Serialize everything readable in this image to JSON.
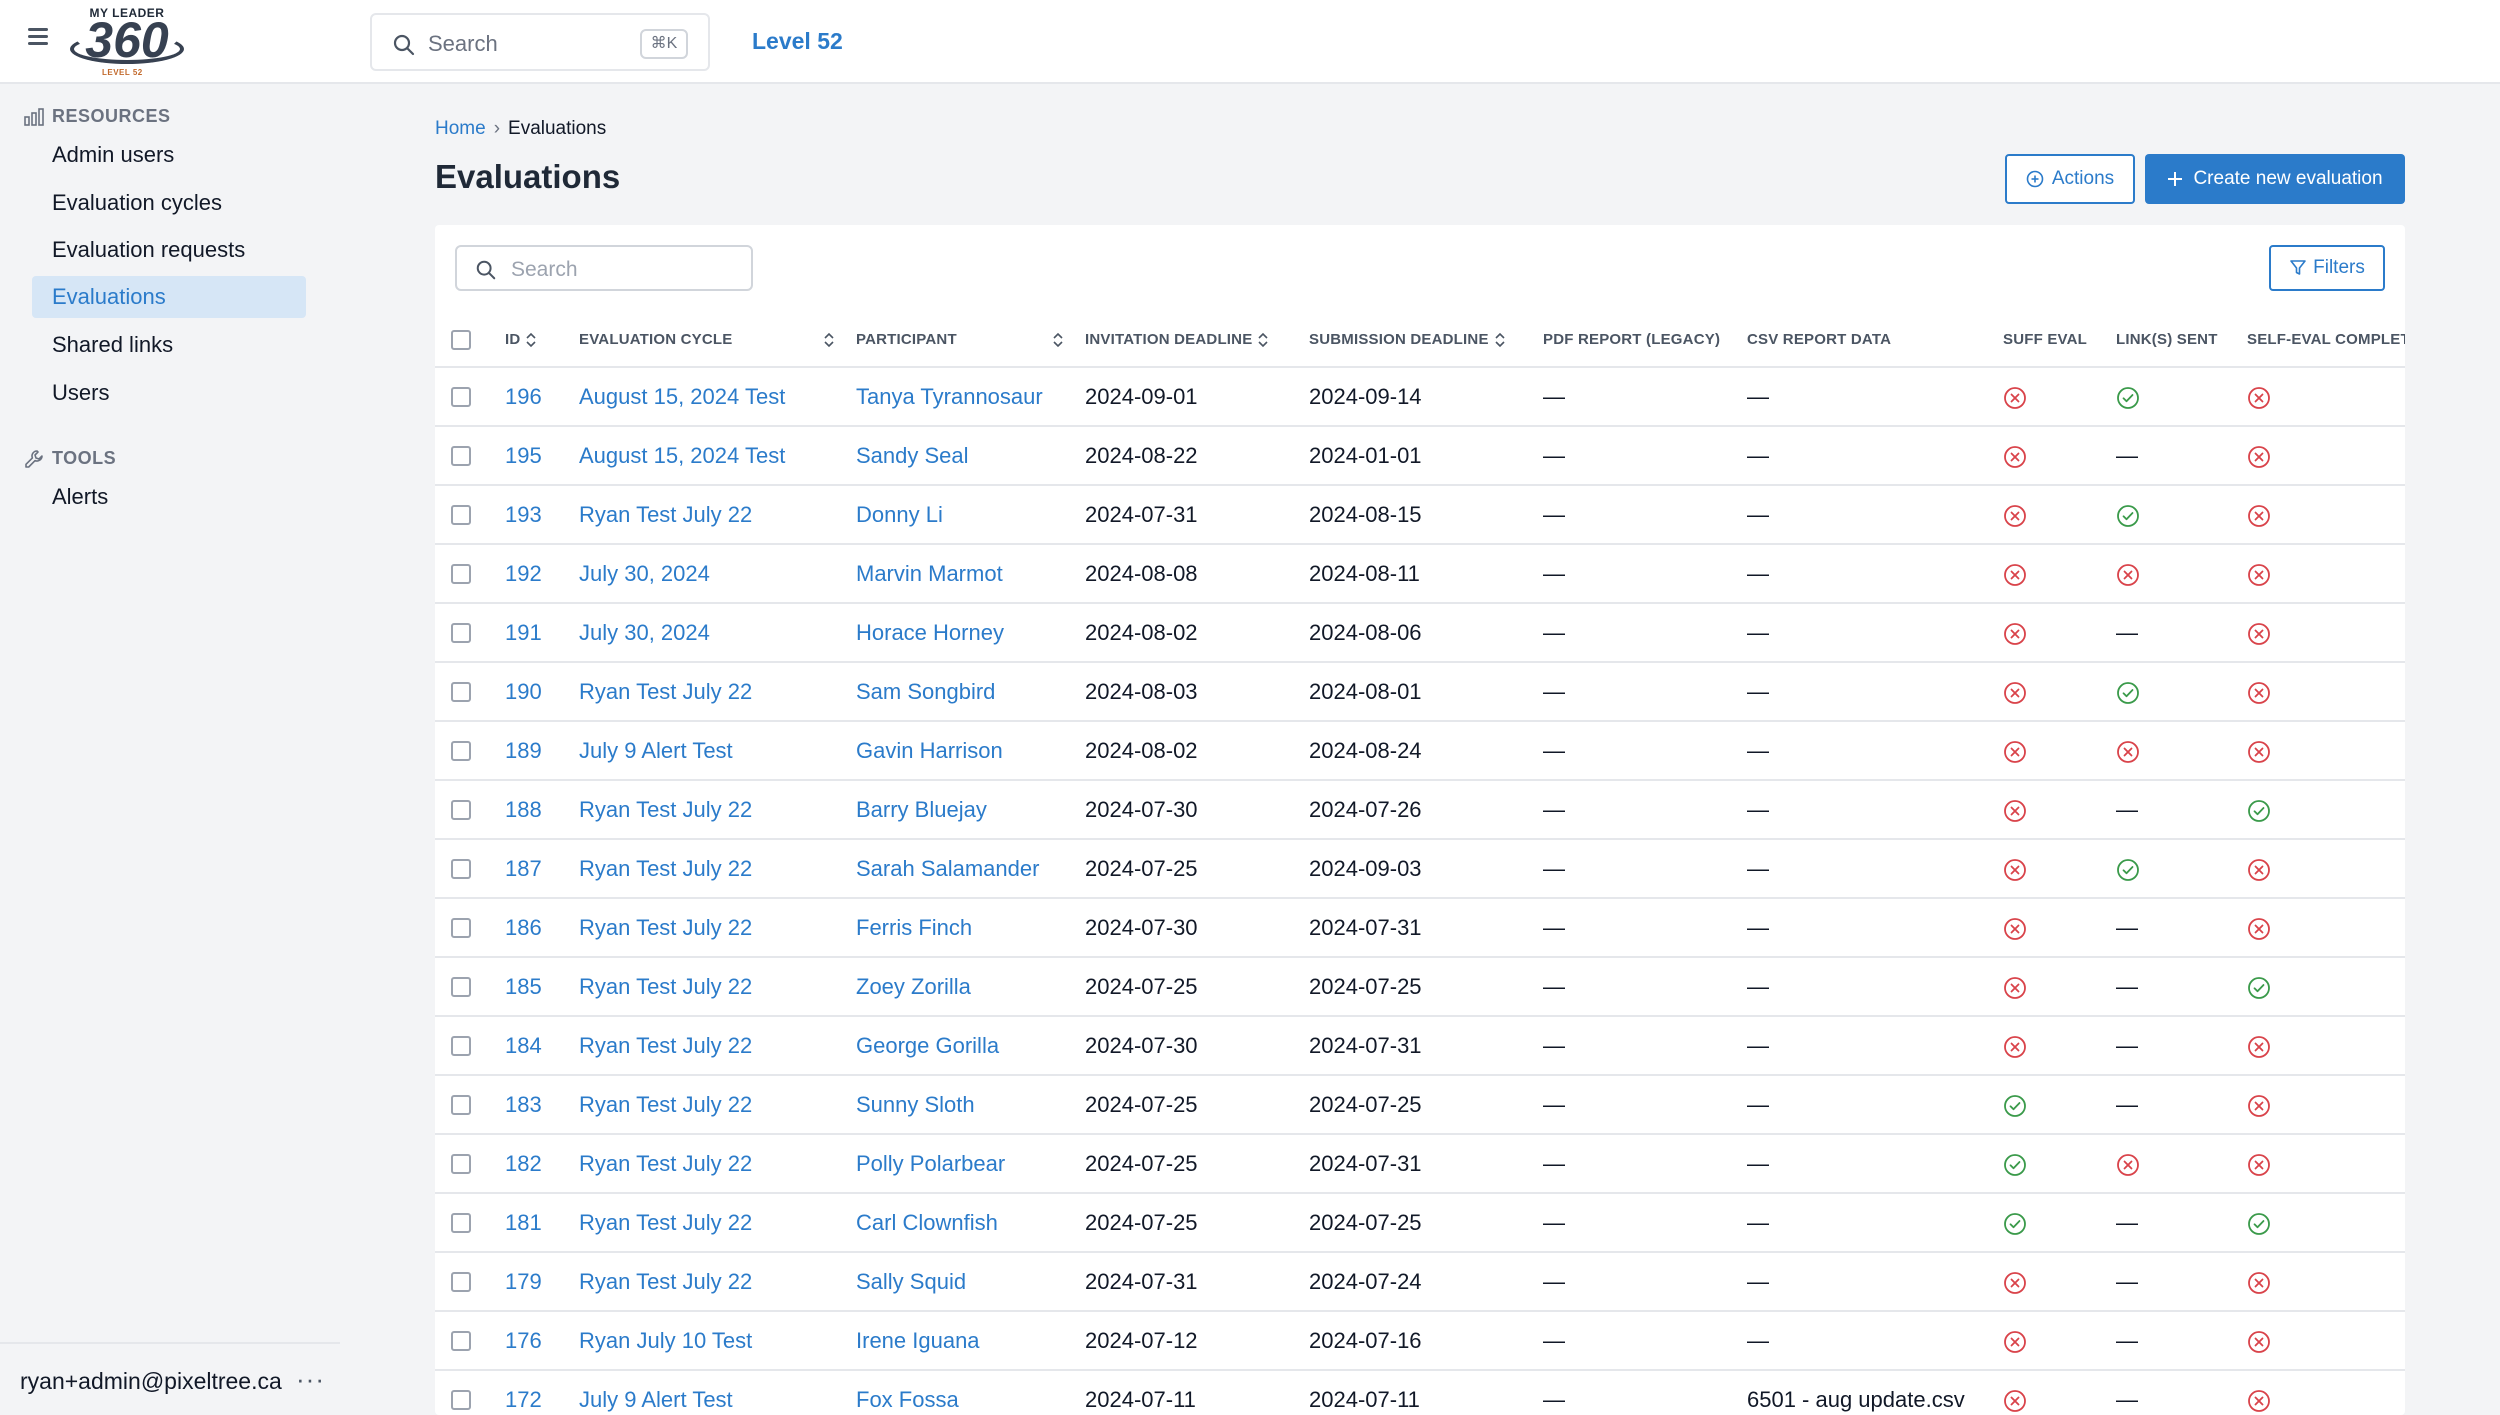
{
  "header": {
    "logo": {
      "top": "MY LEADER",
      "num": "360",
      "sub": "LEVEL 52"
    },
    "search_placeholder": "Search",
    "shortcut": "⌘K",
    "brand_link": "Level 52"
  },
  "sidebar": {
    "resources_label": "RESOURCES",
    "items": [
      {
        "label": "Admin users"
      },
      {
        "label": "Evaluation cycles"
      },
      {
        "label": "Evaluation requests"
      },
      {
        "label": "Evaluations"
      },
      {
        "label": "Shared links"
      },
      {
        "label": "Users"
      }
    ],
    "tools_label": "TOOLS",
    "tools": [
      {
        "label": "Alerts"
      }
    ],
    "user_email": "ryan+admin@pixeltree.ca",
    "more": "···"
  },
  "breadcrumb": {
    "home": "Home",
    "sep": "›",
    "current": "Evaluations"
  },
  "page": {
    "title": "Evaluations",
    "actions_label": "Actions",
    "create_label": "Create new evaluation",
    "search_placeholder": "Search",
    "filters_label": "Filters"
  },
  "table": {
    "headers": {
      "id": "ID",
      "cycle": "EVALUATION CYCLE",
      "participant": "PARTICIPANT",
      "invitation": "INVITATION DEADLINE",
      "submission": "SUBMISSION DEADLINE",
      "pdf": "PDF REPORT (LEGACY)",
      "csv": "CSV REPORT DATA",
      "suff": "SUFF EVAL",
      "links": "LINK(S) SENT",
      "self": "SELF-EVAL COMPLET"
    },
    "rows": [
      {
        "id": "196",
        "cycle": "August 15, 2024 Test",
        "participant": "Tanya Tyrannosaur",
        "inv": "2024-09-01",
        "sub": "2024-09-14",
        "pdf": "—",
        "csv": "—",
        "suff": "no",
        "links": "yes",
        "self": "no"
      },
      {
        "id": "195",
        "cycle": "August 15, 2024 Test",
        "participant": "Sandy Seal",
        "inv": "2024-08-22",
        "sub": "2024-01-01",
        "pdf": "—",
        "csv": "—",
        "suff": "no",
        "links": "none",
        "self": "no"
      },
      {
        "id": "193",
        "cycle": "Ryan Test July 22",
        "participant": "Donny Li",
        "inv": "2024-07-31",
        "sub": "2024-08-15",
        "pdf": "—",
        "csv": "—",
        "suff": "no",
        "links": "yes",
        "self": "no"
      },
      {
        "id": "192",
        "cycle": "July 30, 2024",
        "participant": "Marvin Marmot",
        "inv": "2024-08-08",
        "sub": "2024-08-11",
        "pdf": "—",
        "csv": "—",
        "suff": "no",
        "links": "no",
        "self": "no"
      },
      {
        "id": "191",
        "cycle": "July 30, 2024",
        "participant": "Horace Horney",
        "inv": "2024-08-02",
        "sub": "2024-08-06",
        "pdf": "—",
        "csv": "—",
        "suff": "no",
        "links": "none",
        "self": "no"
      },
      {
        "id": "190",
        "cycle": "Ryan Test July 22",
        "participant": "Sam Songbird",
        "inv": "2024-08-03",
        "sub": "2024-08-01",
        "pdf": "—",
        "csv": "—",
        "suff": "no",
        "links": "yes",
        "self": "no"
      },
      {
        "id": "189",
        "cycle": "July 9 Alert Test",
        "participant": "Gavin Harrison",
        "inv": "2024-08-02",
        "sub": "2024-08-24",
        "pdf": "—",
        "csv": "—",
        "suff": "no",
        "links": "no",
        "self": "no"
      },
      {
        "id": "188",
        "cycle": "Ryan Test July 22",
        "participant": "Barry Bluejay",
        "inv": "2024-07-30",
        "sub": "2024-07-26",
        "pdf": "—",
        "csv": "—",
        "suff": "no",
        "links": "none",
        "self": "yes"
      },
      {
        "id": "187",
        "cycle": "Ryan Test July 22",
        "participant": "Sarah Salamander",
        "inv": "2024-07-25",
        "sub": "2024-09-03",
        "pdf": "—",
        "csv": "—",
        "suff": "no",
        "links": "yes",
        "self": "no"
      },
      {
        "id": "186",
        "cycle": "Ryan Test July 22",
        "participant": "Ferris Finch",
        "inv": "2024-07-30",
        "sub": "2024-07-31",
        "pdf": "—",
        "csv": "—",
        "suff": "no",
        "links": "none",
        "self": "no"
      },
      {
        "id": "185",
        "cycle": "Ryan Test July 22",
        "participant": "Zoey Zorilla",
        "inv": "2024-07-25",
        "sub": "2024-07-25",
        "pdf": "—",
        "csv": "—",
        "suff": "no",
        "links": "none",
        "self": "yes"
      },
      {
        "id": "184",
        "cycle": "Ryan Test July 22",
        "participant": "George Gorilla",
        "inv": "2024-07-30",
        "sub": "2024-07-31",
        "pdf": "—",
        "csv": "—",
        "suff": "no",
        "links": "none",
        "self": "no"
      },
      {
        "id": "183",
        "cycle": "Ryan Test July 22",
        "participant": "Sunny Sloth",
        "inv": "2024-07-25",
        "sub": "2024-07-25",
        "pdf": "—",
        "csv": "—",
        "suff": "yes",
        "links": "none",
        "self": "no"
      },
      {
        "id": "182",
        "cycle": "Ryan Test July 22",
        "participant": "Polly Polarbear",
        "inv": "2024-07-25",
        "sub": "2024-07-31",
        "pdf": "—",
        "csv": "—",
        "suff": "yes",
        "links": "no",
        "self": "no"
      },
      {
        "id": "181",
        "cycle": "Ryan Test July 22",
        "participant": "Carl Clownfish",
        "inv": "2024-07-25",
        "sub": "2024-07-25",
        "pdf": "—",
        "csv": "—",
        "suff": "yes",
        "links": "none",
        "self": "yes"
      },
      {
        "id": "179",
        "cycle": "Ryan Test July 22",
        "participant": "Sally Squid",
        "inv": "2024-07-31",
        "sub": "2024-07-24",
        "pdf": "—",
        "csv": "—",
        "suff": "no",
        "links": "none",
        "self": "no"
      },
      {
        "id": "176",
        "cycle": "Ryan July 10 Test",
        "participant": "Irene Iguana",
        "inv": "2024-07-12",
        "sub": "2024-07-16",
        "pdf": "—",
        "csv": "—",
        "suff": "no",
        "links": "none",
        "self": "no"
      },
      {
        "id": "172",
        "cycle": "July 9 Alert Test",
        "participant": "Fox Fossa",
        "inv": "2024-07-11",
        "sub": "2024-07-11",
        "pdf": "—",
        "csv": "6501 - aug update.csv",
        "suff": "no",
        "links": "none",
        "self": "no"
      }
    ]
  },
  "colors": {
    "accent": "#2b7bca",
    "success": "#3a9a4a",
    "danger": "#d9434a",
    "active_bg": "#d6e6f6"
  }
}
